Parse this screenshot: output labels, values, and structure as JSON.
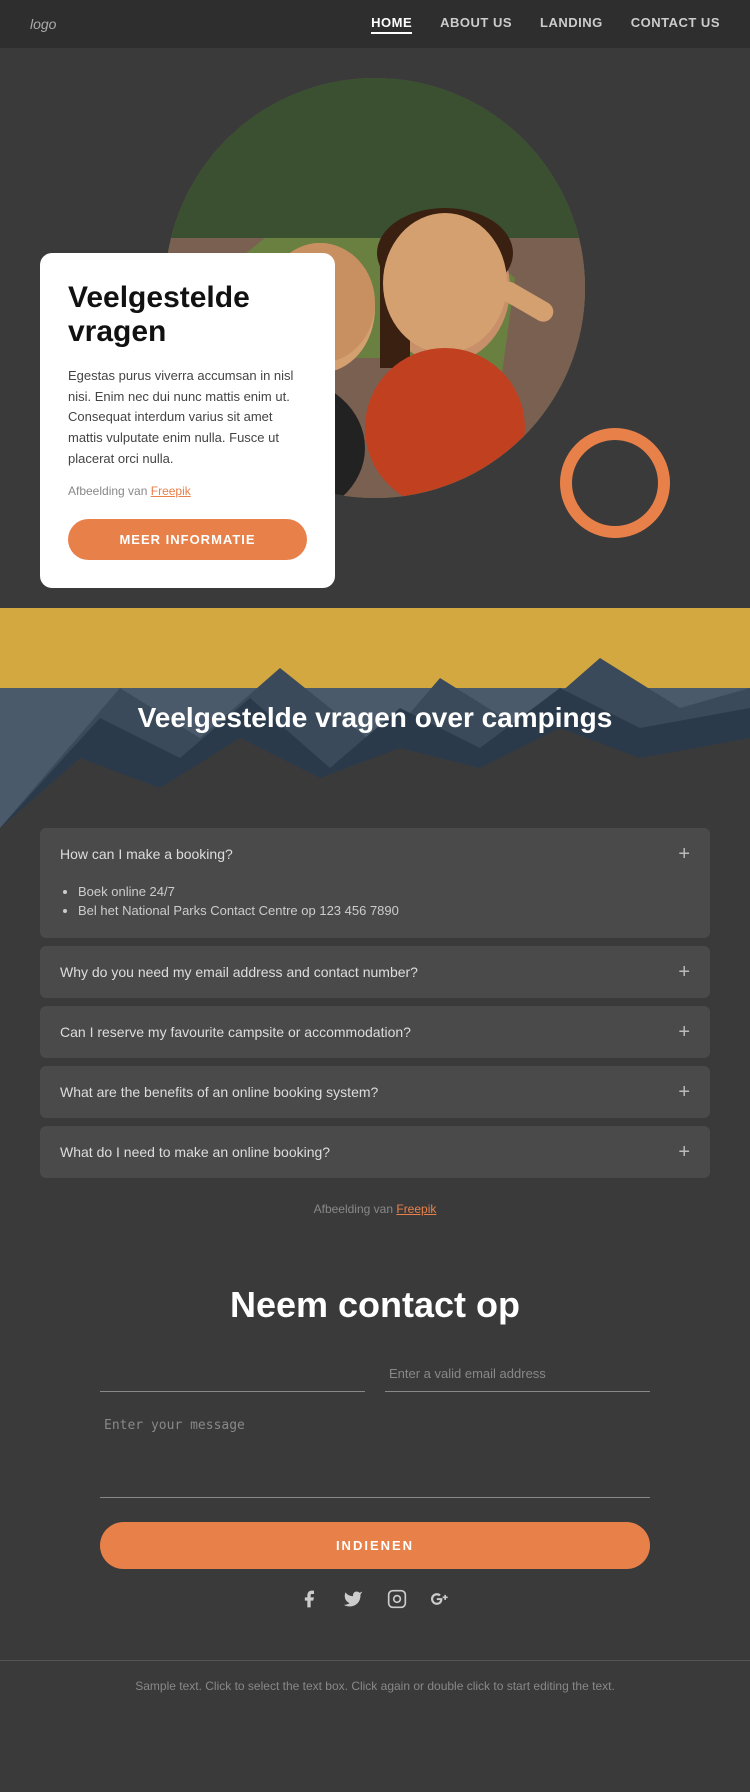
{
  "nav": {
    "logo": "logo",
    "links": [
      {
        "label": "HOME",
        "active": true
      },
      {
        "label": "ABOUT US",
        "active": false
      },
      {
        "label": "LANDING",
        "active": false
      },
      {
        "label": "CONTACT US",
        "active": false
      }
    ]
  },
  "hero": {
    "title": "Veelgestelde vragen",
    "body": "Egestas purus viverra accumsan in nisl nisi. Enim nec dui nunc mattis enim ut. Consequat interdum varius sit amet mattis vulputate enim nulla. Fusce ut placerat orci nulla.",
    "freepik_label": "Afbeelding van",
    "freepik_link": "Freepik",
    "button_label": "MEER INFORMATIE"
  },
  "mountain": {
    "title": "Veelgestelde vragen over campings"
  },
  "faq": {
    "items": [
      {
        "question": "How can I make a booking?",
        "open": true,
        "answers": [
          "Boek online 24/7",
          "Bel het National Parks Contact Centre op 123 456 7890"
        ]
      },
      {
        "question": "Why do you need my email address and contact number?",
        "open": false,
        "answers": []
      },
      {
        "question": "Can I reserve my favourite campsite or accommodation?",
        "open": false,
        "answers": []
      },
      {
        "question": "What are the benefits of an online booking system?",
        "open": false,
        "answers": []
      },
      {
        "question": "What do I need to make an online booking?",
        "open": false,
        "answers": []
      }
    ],
    "freepik_label": "Afbeelding van",
    "freepik_link": "Freepik"
  },
  "contact": {
    "title": "Neem contact op",
    "name_placeholder": "",
    "email_placeholder": "Enter a valid email address",
    "message_placeholder": "Enter your message",
    "submit_label": "INDIENEN"
  },
  "social": {
    "icons": [
      "f",
      "t",
      "ig",
      "g+"
    ]
  },
  "footer": {
    "text": "Sample text. Click to select the text box. Click again or double click to start editing the text."
  }
}
